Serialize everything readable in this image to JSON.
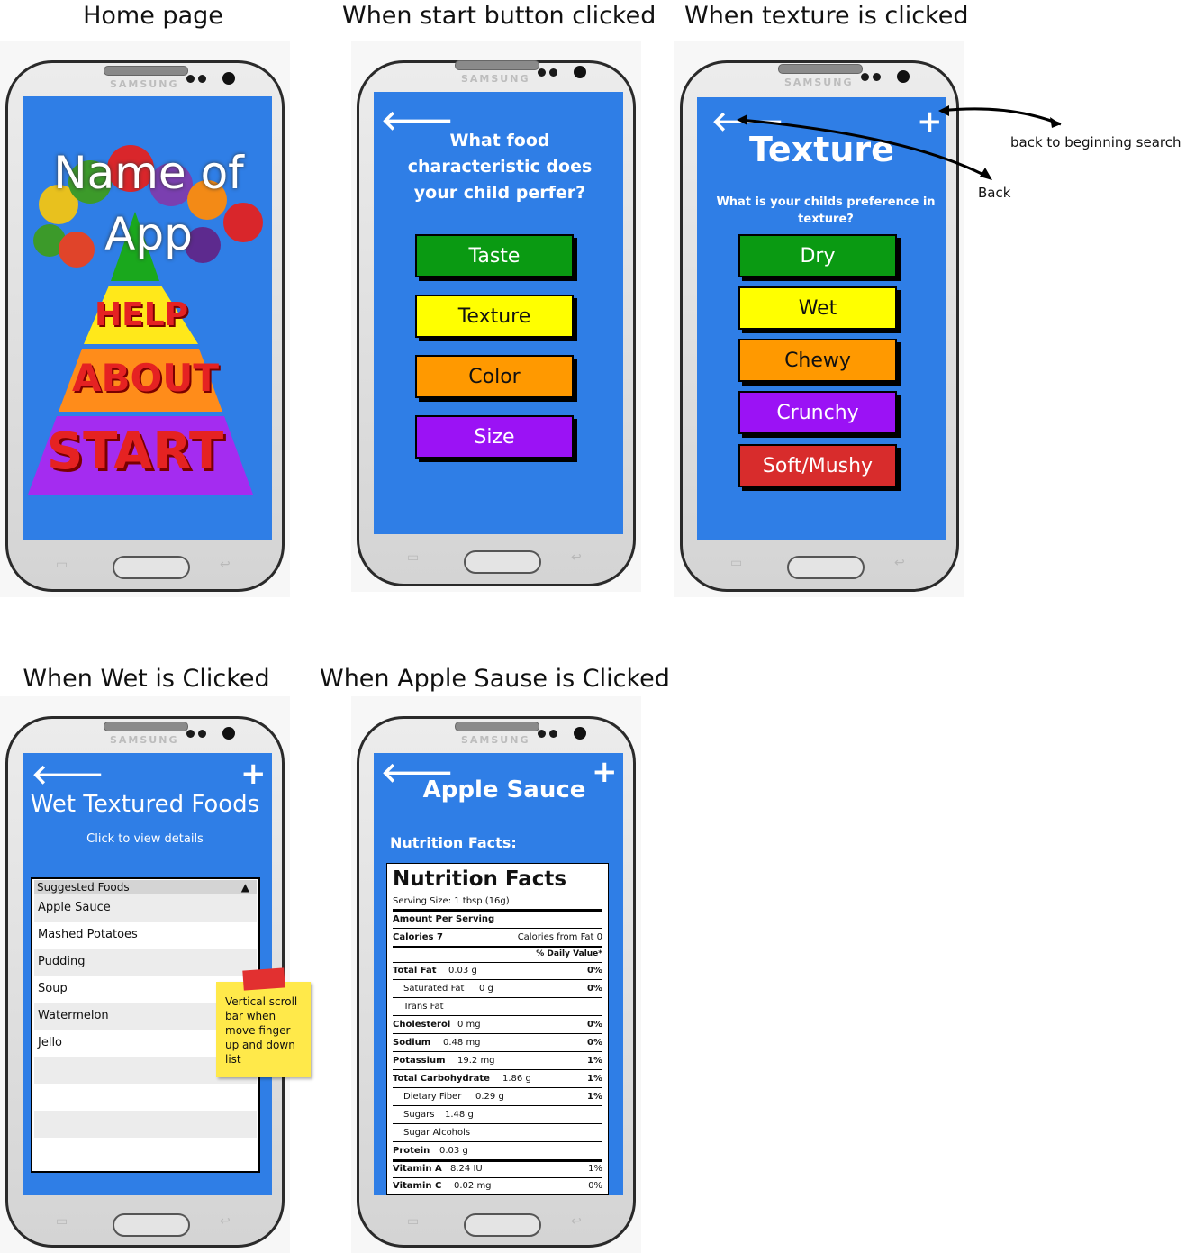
{
  "captions": {
    "home": "Home page",
    "start": "When start button clicked",
    "texture": "When texture is clicked",
    "wet": "When Wet is Clicked",
    "apple": "When Apple Sause is Clicked"
  },
  "phone": {
    "brand": "SAMSUNG"
  },
  "home": {
    "app_name": "Name of App",
    "help": "HELP",
    "about": "ABOUT",
    "start": "START"
  },
  "characteristic": {
    "back_icon": "arrow-left-icon",
    "question": "What food characteristic does your child perfer?",
    "buttons": [
      "Taste",
      "Texture",
      "Color",
      "Size"
    ],
    "colors": [
      "#0a9a12",
      "#ffff00",
      "#ff9900",
      "#9b12f5"
    ]
  },
  "texture": {
    "title": "Texture",
    "question": "What is your childs preference in texture?",
    "buttons": [
      "Dry",
      "Wet",
      "Chewy",
      "Crunchy",
      "Soft/Mushy"
    ],
    "colors": [
      "#0a9a12",
      "#ffff00",
      "#ff9900",
      "#9b12f5",
      "#d82c2c"
    ],
    "annotations": {
      "home": "back to beginning search",
      "back": "Back"
    }
  },
  "wet": {
    "title": "Wet Textured Foods",
    "subtitle": "Click to view details",
    "list_header": "Suggested Foods",
    "items": [
      "Apple Sauce",
      "Mashed Potatoes",
      "Pudding",
      "Soup",
      "Watermelon",
      "Jello",
      "",
      "",
      "",
      ""
    ],
    "sticky_note": "Vertical scroll bar when move finger up and down list"
  },
  "apple": {
    "title": "Apple Sauce",
    "section_label": "Nutrition Facts:",
    "label_title": "Nutrition Facts",
    "serving": "Serving Size: 1 tbsp (16g)",
    "amount_per": "Amount Per Serving",
    "calories": "Calories 7",
    "calories_fat": "Calories from Fat 0",
    "daily_value": "% Daily Value*",
    "rows": [
      {
        "name": "Total Fat",
        "amount": "0.03 g",
        "dv": "0%"
      },
      {
        "name": "Saturated Fat",
        "amount": "0 g",
        "dv": "0%"
      },
      {
        "name": "Trans Fat",
        "amount": "",
        "dv": ""
      },
      {
        "name": "Cholesterol",
        "amount": "0 mg",
        "dv": "0%"
      },
      {
        "name": "Sodium",
        "amount": "0.48 mg",
        "dv": "0%"
      },
      {
        "name": "Potassium",
        "amount": "19.2 mg",
        "dv": "1%"
      },
      {
        "name": "Total Carbohydrate",
        "amount": "1.86 g",
        "dv": "1%"
      },
      {
        "name": "Dietary Fiber",
        "amount": "0.29 g",
        "dv": "1%"
      },
      {
        "name": "Sugars",
        "amount": "1.48 g",
        "dv": ""
      },
      {
        "name": "Sugar Alcohols",
        "amount": "",
        "dv": ""
      },
      {
        "name": "Protein",
        "amount": "0.03 g",
        "dv": ""
      },
      {
        "name": "Vitamin A",
        "amount": "8.24 IU",
        "dv": "1%"
      },
      {
        "name": "Vitamin C",
        "amount": "0.02 mg",
        "dv": "0%"
      }
    ]
  }
}
